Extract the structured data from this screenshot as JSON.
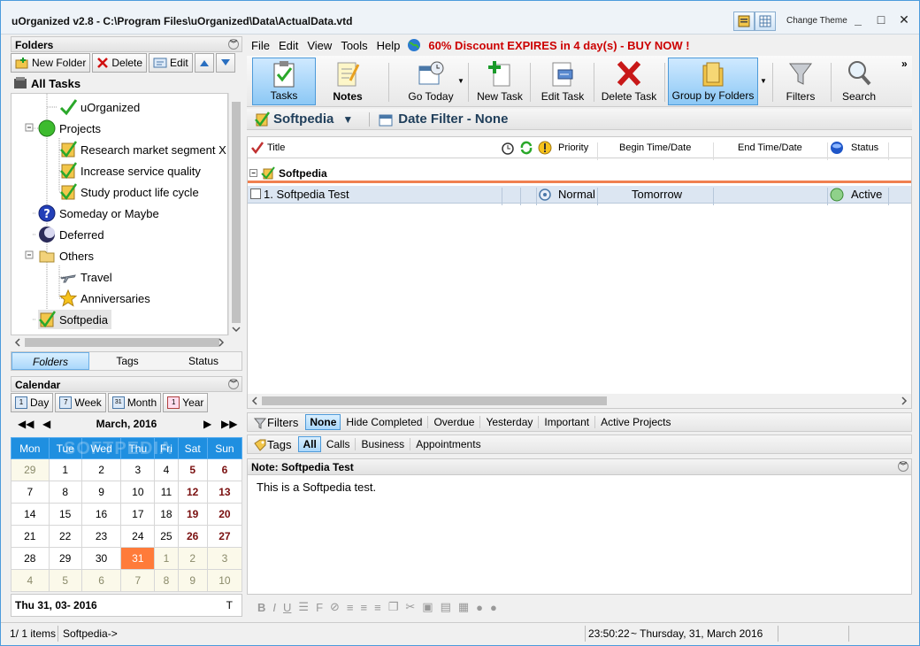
{
  "window": {
    "title": "uOrganized v2.8 - C:\\Program Files\\uOrganized\\Data\\ActualData.vtd",
    "change_theme": "Change Theme"
  },
  "folders_panel": {
    "title": "Folders",
    "buttons": {
      "new_folder": "New Folder",
      "delete": "Delete",
      "edit": "Edit"
    },
    "all_tasks": "All Tasks",
    "tree": [
      {
        "label": "uOrganized",
        "icon": "checkmark-icon"
      },
      {
        "label": "Projects",
        "icon": "green-circle-icon"
      },
      {
        "label": "Research market segment X",
        "icon": "task-check-icon"
      },
      {
        "label": "Increase service quality",
        "icon": "task-check-icon"
      },
      {
        "label": "Study product life cycle",
        "icon": "task-check-icon"
      },
      {
        "label": "Someday or Maybe",
        "icon": "question-icon"
      },
      {
        "label": "Deferred",
        "icon": "moon-icon"
      },
      {
        "label": "Others",
        "icon": "folder-icon"
      },
      {
        "label": "Travel",
        "icon": "plane-icon"
      },
      {
        "label": "Anniversaries",
        "icon": "star-icon"
      },
      {
        "label": "Softpedia",
        "icon": "task-check-icon"
      }
    ],
    "tabs": [
      "Folders",
      "Tags",
      "Status"
    ]
  },
  "calendar": {
    "title": "Calendar",
    "views": [
      "Day",
      "Week",
      "Month",
      "Year"
    ],
    "view_icons": [
      "1",
      "7",
      "31",
      "1"
    ],
    "month_label": "March, 2016",
    "weekdays": [
      "Mon",
      "Tue",
      "Wed",
      "Thu",
      "Fri",
      "Sat",
      "Sun"
    ],
    "weeks": [
      [
        "29",
        "1",
        "2",
        "3",
        "4",
        "5",
        "6"
      ],
      [
        "7",
        "8",
        "9",
        "10",
        "11",
        "12",
        "13"
      ],
      [
        "14",
        "15",
        "16",
        "17",
        "18",
        "19",
        "20"
      ],
      [
        "21",
        "22",
        "23",
        "24",
        "25",
        "26",
        "27"
      ],
      [
        "28",
        "29",
        "30",
        "31",
        "1",
        "2",
        "3"
      ],
      [
        "4",
        "5",
        "6",
        "7",
        "8",
        "9",
        "10"
      ]
    ],
    "selected_date": "Thu 31, 03- 2016",
    "selected_suffix": "T",
    "watermark": "SOFTPEDIA"
  },
  "menu": {
    "items": [
      "File",
      "Edit",
      "View",
      "Tools",
      "Help"
    ],
    "promo": "60% Discount EXPIRES in 4 day(s) - BUY NOW !"
  },
  "toolbar": {
    "tasks": "Tasks",
    "notes": "Notes",
    "go_today": "Go Today",
    "new_task": "New Task",
    "edit_task": "Edit Task",
    "delete_task": "Delete Task",
    "group_by_folders": "Group by Folders",
    "filters": "Filters",
    "search": "Search",
    "more": "»"
  },
  "filterbar": {
    "folder": "Softpedia",
    "date_filter": "Date Filter - None"
  },
  "grid": {
    "columns": {
      "title": "Title",
      "priority": "Priority",
      "begin": "Begin Time/Date",
      "end": "End Time/Date",
      "status": "Status"
    },
    "group": "Softpedia",
    "rows": [
      {
        "title": "1. Softpedia Test",
        "priority": "Normal",
        "begin": "Tomorrow",
        "end": "",
        "status": "Active"
      }
    ]
  },
  "filters_strip": {
    "label": "Filters",
    "items": [
      "None",
      "Hide Completed",
      "Overdue",
      "Yesterday",
      "Important",
      "Active Projects"
    ]
  },
  "tags_strip": {
    "label": "Tags",
    "items": [
      "All",
      "Calls",
      "Business",
      "Appointments"
    ]
  },
  "note": {
    "title": "Note: Softpedia Test",
    "text": "This is a Softpedia test."
  },
  "statusbar": {
    "items": "1/ 1 items",
    "path": "Softpedia->",
    "time": "23:50:22",
    "date": "~  Thursday, 31, March 2016"
  },
  "colors": {
    "accent": "#1f8fe0",
    "today": "#ff7b3a",
    "promo": "#cc0000",
    "group_line": "#f08050"
  }
}
